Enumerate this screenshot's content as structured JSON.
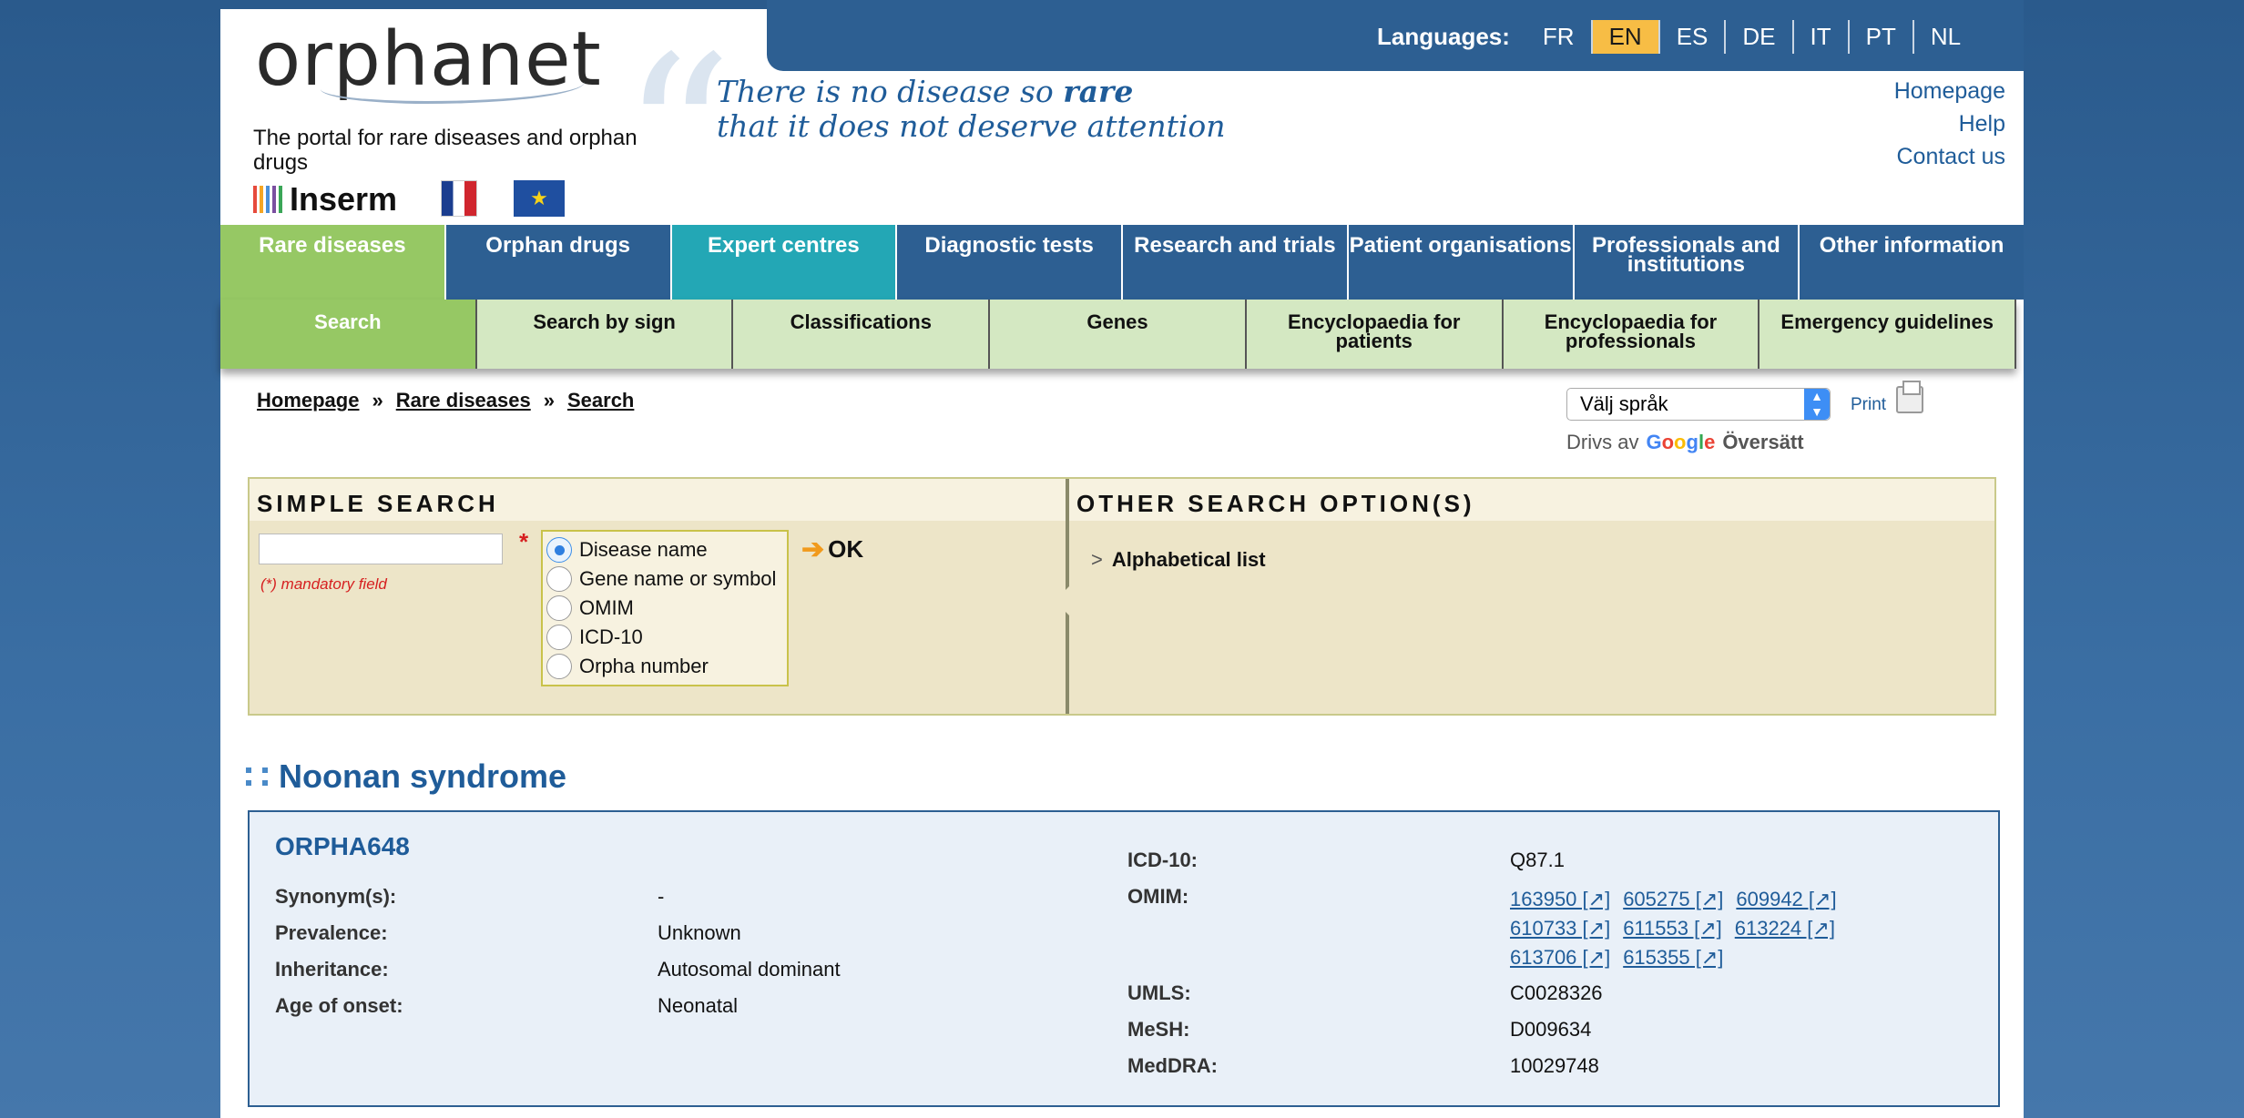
{
  "header": {
    "logo_text": "orphanet",
    "tagline": "The portal for rare diseases and orphan drugs",
    "slogan_line1_pre": "There is no disease so ",
    "slogan_line1_bold": "rare",
    "slogan_line2": "that it does not deserve attention",
    "partner_inserm": "Inserm",
    "languages_label": "Languages:",
    "languages": [
      "FR",
      "EN",
      "ES",
      "DE",
      "IT",
      "PT",
      "NL"
    ],
    "active_language": "EN",
    "links": [
      "Homepage",
      "Help",
      "Contact us"
    ]
  },
  "main_nav": [
    {
      "label": "Rare diseases",
      "color": "#96c864"
    },
    {
      "label": "Orphan drugs",
      "color": "#2d5f92"
    },
    {
      "label": "Expert centres",
      "color": "#23a7b5"
    },
    {
      "label": "Diagnostic tests",
      "color": "#2d5f92"
    },
    {
      "label": "Research and trials",
      "color": "#2d5f92"
    },
    {
      "label": "Patient organisations",
      "color": "#2d5f92"
    },
    {
      "label": "Professionals and institutions",
      "color": "#2d5f92"
    },
    {
      "label": "Other information",
      "color": "#2d5f92"
    }
  ],
  "sub_nav": [
    "Search",
    "Search by sign",
    "Classifications",
    "Genes",
    "Encyclopaedia for patients",
    "Encyclopaedia for professionals",
    "Emergency guidelines"
  ],
  "breadcrumb": [
    "Homepage",
    "Rare diseases",
    "Search"
  ],
  "breadcrumb_sep": "»",
  "translate": {
    "select_value": "Välj språk",
    "print_label": "Print",
    "powered_by": "Drivs av",
    "google": "Google",
    "translate_word": "Översätt"
  },
  "simple_search": {
    "title": "SIMPLE SEARCH",
    "input_value": "",
    "required_mark": "*",
    "mandatory_note": "(*) mandatory field",
    "options": [
      "Disease name",
      "Gene name or symbol",
      "OMIM",
      "ICD-10",
      "Orpha number"
    ],
    "selected_option": "Disease name",
    "ok_label": "OK"
  },
  "other_search": {
    "title": "OTHER SEARCH OPTION(S)",
    "items": [
      "Alphabetical list"
    ]
  },
  "disease": {
    "name": "Noonan syndrome",
    "orpha_code": "ORPHA648",
    "left_fields": [
      {
        "label": "Synonym(s):",
        "value": "-"
      },
      {
        "label": "Prevalence:",
        "value": "Unknown"
      },
      {
        "label": "Inheritance:",
        "value": "Autosomal dominant"
      },
      {
        "label": "Age of onset:",
        "value": "Neonatal"
      }
    ],
    "icd10_label": "ICD-10:",
    "icd10_value": "Q87.1",
    "omim_label": "OMIM:",
    "omim_links": [
      "163950 [↗]",
      "605275 [↗]",
      "609942 [↗]",
      "610733 [↗]",
      "611553 [↗]",
      "613224 [↗]",
      "613706 [↗]",
      "615355 [↗]"
    ],
    "right_fields": [
      {
        "label": "UMLS:",
        "value": "C0028326"
      },
      {
        "label": "MeSH:",
        "value": "D009634"
      },
      {
        "label": "MedDRA:",
        "value": "10029748"
      }
    ]
  }
}
